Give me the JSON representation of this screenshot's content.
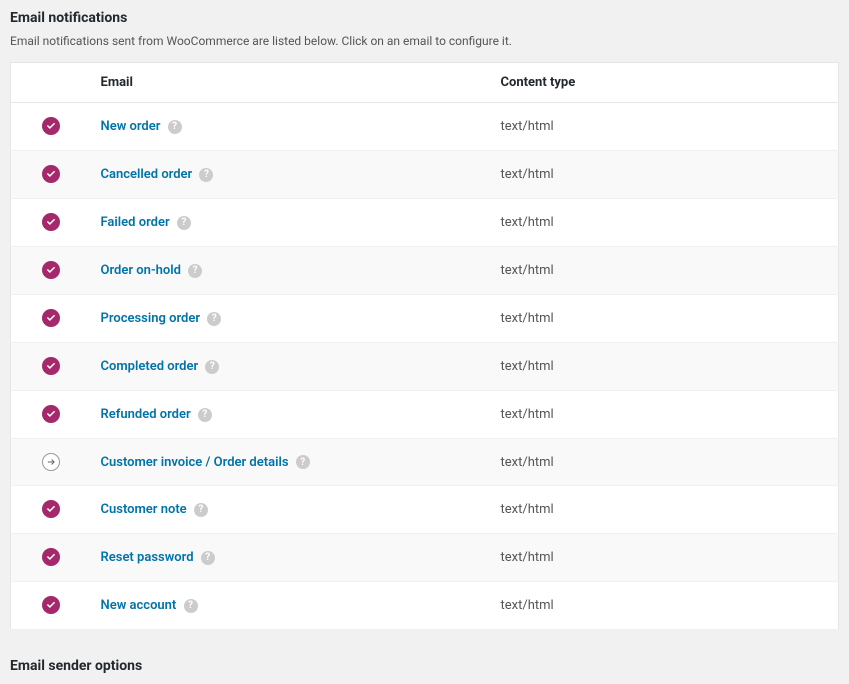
{
  "section": {
    "title": "Email notifications",
    "description": "Email notifications sent from WooCommerce are listed below. Click on an email to configure it."
  },
  "table": {
    "headers": {
      "status": "",
      "email": "Email",
      "content_type": "Content type"
    },
    "rows": [
      {
        "status": "enabled",
        "label": "New order",
        "content_type": "text/html"
      },
      {
        "status": "enabled",
        "label": "Cancelled order",
        "content_type": "text/html"
      },
      {
        "status": "enabled",
        "label": "Failed order",
        "content_type": "text/html"
      },
      {
        "status": "enabled",
        "label": "Order on-hold",
        "content_type": "text/html"
      },
      {
        "status": "enabled",
        "label": "Processing order",
        "content_type": "text/html"
      },
      {
        "status": "enabled",
        "label": "Completed order",
        "content_type": "text/html"
      },
      {
        "status": "enabled",
        "label": "Refunded order",
        "content_type": "text/html"
      },
      {
        "status": "manual",
        "label": "Customer invoice / Order details",
        "content_type": "text/html"
      },
      {
        "status": "enabled",
        "label": "Customer note",
        "content_type": "text/html"
      },
      {
        "status": "enabled",
        "label": "Reset password",
        "content_type": "text/html"
      },
      {
        "status": "enabled",
        "label": "New account",
        "content_type": "text/html"
      }
    ]
  },
  "next_section": {
    "title": "Email sender options"
  }
}
